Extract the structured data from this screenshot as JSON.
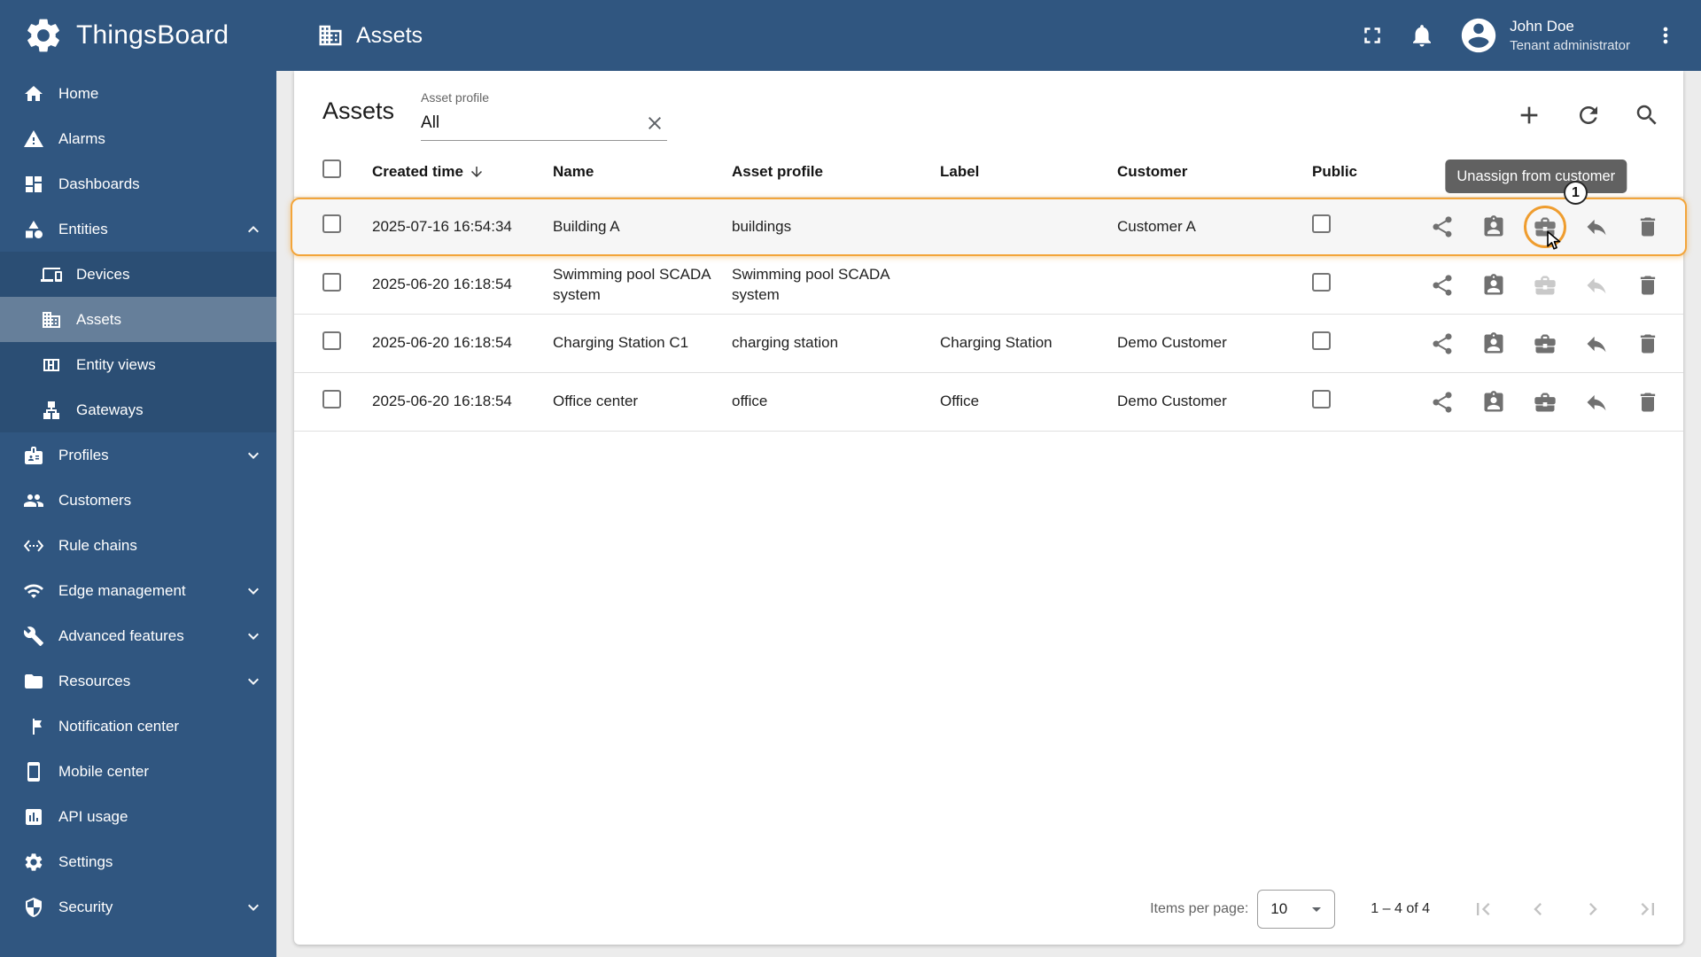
{
  "app": {
    "brand": "ThingsBoard",
    "page_title": "Assets"
  },
  "topbar": {
    "user_name": "John Doe",
    "user_role": "Tenant administrator"
  },
  "sidebar": {
    "items": [
      {
        "label": "Home",
        "icon": "home"
      },
      {
        "label": "Alarms",
        "icon": "alarm"
      },
      {
        "label": "Dashboards",
        "icon": "dashboards"
      },
      {
        "label": "Entities",
        "icon": "entities",
        "expanded": true,
        "children": [
          {
            "label": "Devices",
            "icon": "devices"
          },
          {
            "label": "Assets",
            "icon": "assets",
            "selected": true
          },
          {
            "label": "Entity views",
            "icon": "entity-views"
          },
          {
            "label": "Gateways",
            "icon": "gateways"
          }
        ]
      },
      {
        "label": "Profiles",
        "icon": "profiles",
        "collapsed": true
      },
      {
        "label": "Customers",
        "icon": "customers"
      },
      {
        "label": "Rule chains",
        "icon": "rule-chains"
      },
      {
        "label": "Edge management",
        "icon": "edge",
        "collapsed": true
      },
      {
        "label": "Advanced features",
        "icon": "advanced",
        "collapsed": true
      },
      {
        "label": "Resources",
        "icon": "resources",
        "collapsed": true
      },
      {
        "label": "Notification center",
        "icon": "notification-center"
      },
      {
        "label": "Mobile center",
        "icon": "mobile-center"
      },
      {
        "label": "API usage",
        "icon": "api-usage"
      },
      {
        "label": "Settings",
        "icon": "settings"
      },
      {
        "label": "Security",
        "icon": "security",
        "collapsed": true
      }
    ]
  },
  "content": {
    "title": "Assets",
    "filter": {
      "label": "Asset profile",
      "value": "All"
    },
    "table": {
      "columns": [
        "Created time",
        "Name",
        "Asset profile",
        "Label",
        "Customer",
        "Public"
      ],
      "row_actions": [
        "share",
        "assign-to-customer",
        "unassign-from-customer",
        "make-private",
        "delete"
      ],
      "rows": [
        {
          "created_time": "2025-07-16 16:54:34",
          "name": "Building A",
          "asset_profile": "buildings",
          "label": "",
          "customer": "Customer A",
          "public": false,
          "highlighted": true
        },
        {
          "created_time": "2025-06-20 16:18:54",
          "name": "Swimming pool SCADA system",
          "asset_profile": "Swimming pool SCADA system",
          "label": "",
          "customer": "",
          "public": false,
          "disabled_actions": [
            "unassign-from-customer",
            "make-private"
          ]
        },
        {
          "created_time": "2025-06-20 16:18:54",
          "name": "Charging Station C1",
          "asset_profile": "charging station",
          "label": "Charging Station",
          "customer": "Demo Customer",
          "public": false
        },
        {
          "created_time": "2025-06-20 16:18:54",
          "name": "Office center",
          "asset_profile": "office",
          "label": "Office",
          "customer": "Demo Customer",
          "public": false
        }
      ]
    },
    "annotation": {
      "tooltip": "Unassign from customer",
      "step": "1"
    },
    "paginator": {
      "items_per_page_label": "Items per page:",
      "items_per_page": "10",
      "range": "1 – 4 of 4"
    }
  },
  "colors": {
    "primary": "#305680",
    "highlight": "#f3a53a",
    "tooltip_bg": "#616161",
    "selected_menu": "rgba(255,255,255,0.28)"
  }
}
